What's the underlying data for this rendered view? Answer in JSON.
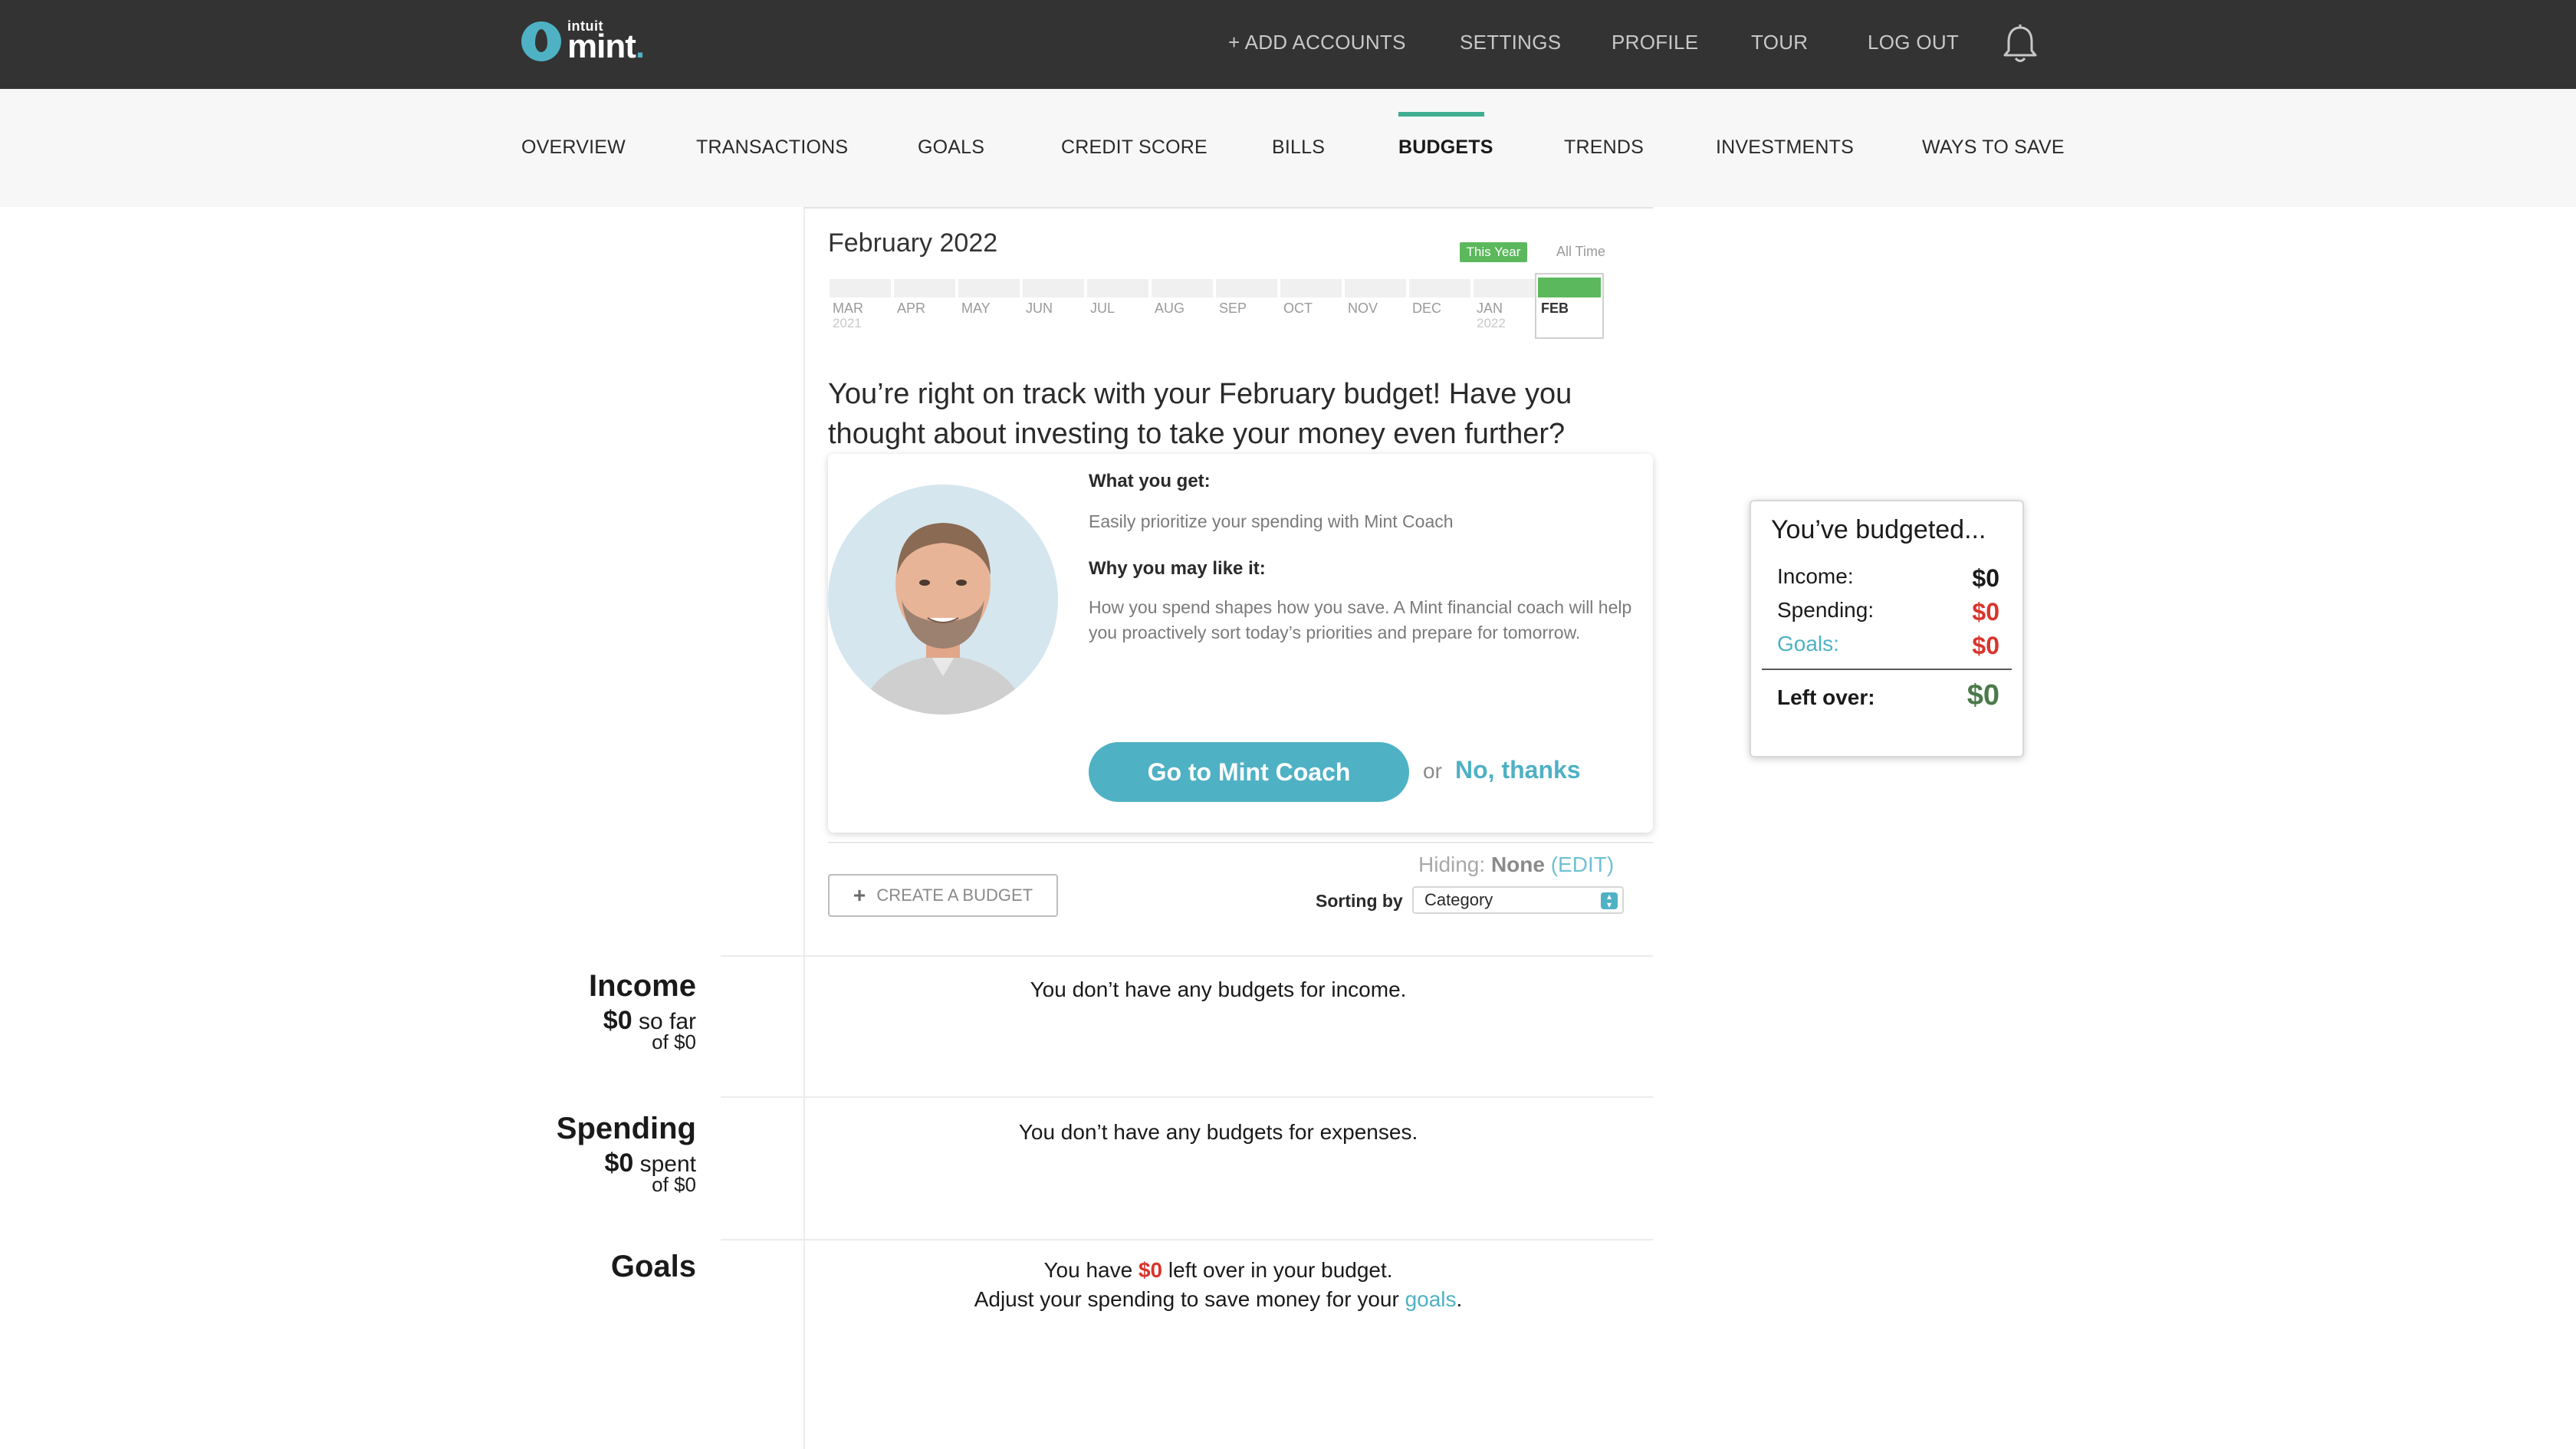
{
  "header": {
    "brand_small": "intuit",
    "brand_large": "mint",
    "nav": [
      "+ ADD ACCOUNTS",
      "SETTINGS",
      "PROFILE",
      "TOUR",
      "LOG OUT"
    ]
  },
  "subnav": {
    "items": [
      "OVERVIEW",
      "TRANSACTIONS",
      "GOALS",
      "CREDIT SCORE",
      "BILLS",
      "BUDGETS",
      "TRENDS",
      "INVESTMENTS",
      "WAYS TO SAVE"
    ],
    "active": "BUDGETS"
  },
  "timeline": {
    "title": "February 2022",
    "range_active": "This Year",
    "range_other": "All Time",
    "months": [
      "MAR",
      "APR",
      "MAY",
      "JUN",
      "JUL",
      "AUG",
      "SEP",
      "OCT",
      "NOV",
      "DEC",
      "JAN",
      "FEB"
    ],
    "year_start": "2021",
    "year_jan": "2022",
    "selected": "FEB"
  },
  "promo": {
    "headline": "You’re right on track with your February budget! Have you thought about investing to take your money even further?",
    "what_heading": "What you get:",
    "what_text": "Easily prioritize your spending with Mint Coach",
    "why_heading": "Why you may like it:",
    "why_text": "How you spend shapes how you save. A Mint financial coach will help you proactively sort today’s priorities and prepare for tomorrow.",
    "cta_label": "Go to Mint Coach",
    "or_text": "or",
    "decline_label": "No, thanks"
  },
  "controls": {
    "hiding_label": "Hiding:",
    "hiding_value": "None",
    "edit_label": "(EDIT)",
    "create_label": "CREATE A BUDGET",
    "sort_label": "Sorting by",
    "sort_value": "Category"
  },
  "sections": {
    "income": {
      "title": "Income",
      "amount": "$0",
      "suffix": "so far",
      "of_label": "of",
      "of_value": "$0",
      "message": "You don’t have any budgets for income."
    },
    "spending": {
      "title": "Spending",
      "amount": "$0",
      "suffix": "spent",
      "of_label": "of",
      "of_value": "$0",
      "message": "You don’t have any budgets for expenses."
    },
    "goals": {
      "title": "Goals",
      "msg_before": "You have",
      "msg_amount": "$0",
      "msg_after": "left over in your budget.",
      "msg2_before": "Adjust your spending to save money for your",
      "msg2_link": "goals",
      "msg2_after": "."
    }
  },
  "summary": {
    "title": "You’ve budgeted...",
    "income_label": "Income:",
    "income_value": "$0",
    "spending_label": "Spending:",
    "spending_value": "$0",
    "goals_label": "Goals:",
    "goals_value": "$0",
    "leftover_label": "Left over:",
    "leftover_value": "$0"
  },
  "colors": {
    "topbar": "#333333",
    "accent_teal": "#4fb1c4",
    "accent_green": "#5bb85c",
    "negative_red": "#d9342b",
    "leftover_green": "#4a7a4a"
  },
  "icons": {
    "bell": "bell-icon",
    "plus": "plus-icon",
    "logo": "mint-leaf-icon"
  }
}
